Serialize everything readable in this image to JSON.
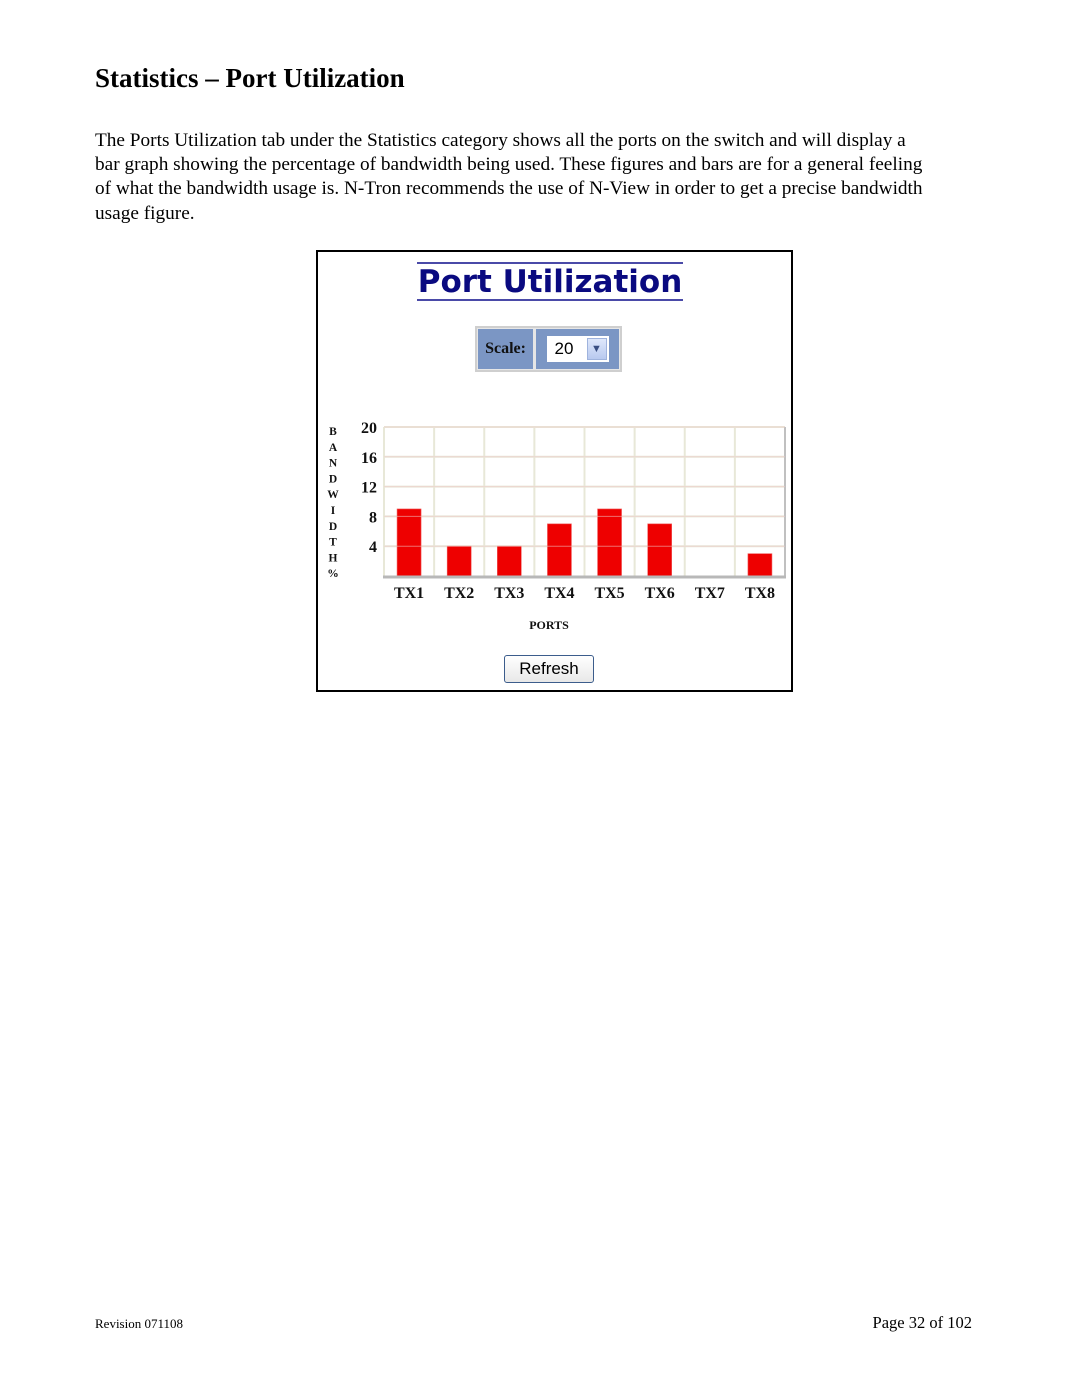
{
  "document": {
    "heading": "Statistics – Port Utilization",
    "paragraph_lines": [
      "The Ports Utilization tab under the Statistics category shows all the ports on the switch and will display a",
      "bar graph showing the percentage of bandwidth being used. These figures and bars are for a general feeling",
      "of what the bandwidth usage is.  N-Tron recommends the use of N-View in order to get a precise bandwidth",
      "usage figure."
    ],
    "footer": {
      "revision": "Revision 071108",
      "page": "Page 32 of 102"
    }
  },
  "screenshot": {
    "title": "Port Utilization",
    "scale_label": "Scale:",
    "scale_value": "20",
    "refresh_label": "Refresh",
    "colors": {
      "title": "#0a0a80",
      "bar": "#ee0000",
      "scale_bg": "#7b96c4",
      "grid": "#e8e8d8"
    }
  },
  "chart_data": {
    "type": "bar",
    "title": "Port Utilization",
    "categories": [
      "TX1",
      "TX2",
      "TX3",
      "TX4",
      "TX5",
      "TX6",
      "TX7",
      "TX8"
    ],
    "values": [
      9,
      4,
      4,
      7,
      9,
      7,
      0,
      3
    ],
    "xlabel": "PORTS",
    "ylabel": "BANDWIDTH %",
    "ylabel_letters": [
      "B",
      "A",
      "N",
      "D",
      "W",
      "I",
      "D",
      "T",
      "H",
      "%"
    ],
    "yticks": [
      4,
      8,
      12,
      16,
      20
    ],
    "ylim": [
      0,
      20
    ],
    "grid": true,
    "legend": "none"
  }
}
